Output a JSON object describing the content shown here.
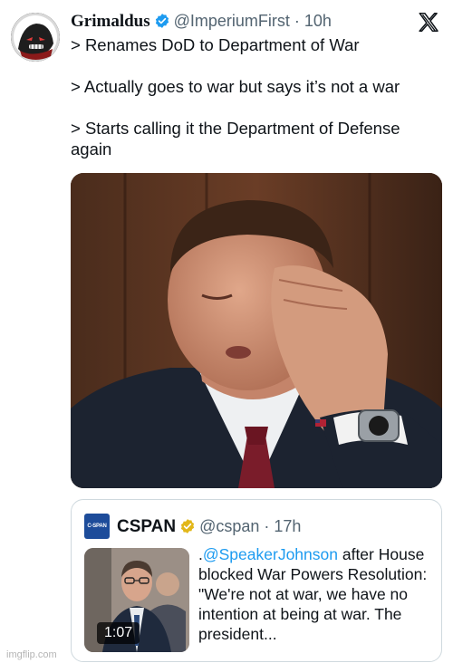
{
  "tweet": {
    "display_name": "Grimaldus",
    "handle_time": "@ImperiumFirst · 10h",
    "lines": [
      "> Renames DoD to Department of War",
      "> Actually goes to war but says it’s not a war",
      "> Starts calling it the Department of Defense again"
    ]
  },
  "quote": {
    "avatar_text": "C-SPAN",
    "display_name": "CSPAN",
    "handle_time": "@cspan · 17h",
    "mention": "@SpeakerJohnson",
    "text_prefix": ".",
    "text_rest": " after House blocked War Powers Resolution: \"We're not at war, we have no intention at being at war. The president...",
    "video_duration": "1:07"
  },
  "watermark": "imgflip.com",
  "colors": {
    "verified_blue": "#1d9bf0",
    "verified_gold": "#e2b719",
    "text": "#0f1419",
    "secondary": "#536471",
    "link": "#1d9bf0",
    "border": "#cfd9de"
  },
  "icons": {
    "x_logo": "x-logo-icon",
    "verified": "verified-badge-icon"
  }
}
